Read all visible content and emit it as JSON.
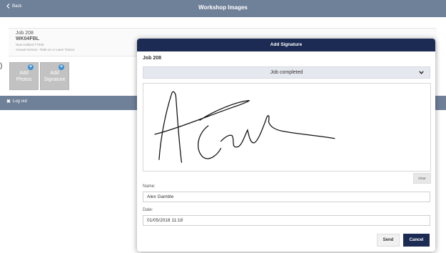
{
  "topbar": {
    "back_label": "Back",
    "title": "Workshop Images"
  },
  "job_card": {
    "job_number": "Job 208",
    "registration": "WK04FBL",
    "model": "New Holland T7030",
    "service": "Annual Service - Ride-on or Lawn Tractor"
  },
  "tiles": [
    {
      "label_line1": "Add",
      "label_line2": "Photos",
      "icon": "plus-circle-icon"
    },
    {
      "label_line1": "Add",
      "label_line2": "Signature",
      "icon": "plus-circle-icon"
    }
  ],
  "logout_label": "Log out",
  "modal": {
    "title": "Add Signature",
    "job": "Job 208",
    "status_selected": "Job completed",
    "clear_label": "Clear",
    "name_label": "Name:",
    "name_value": "Alex Gamble",
    "date_label": "Date:",
    "date_value": "01/05/2018 11:18",
    "send_label": "Send",
    "cancel_label": "Cancel"
  },
  "colors": {
    "topbar": "#6f8199",
    "modal_header": "#1b2b53",
    "tile": "#c2c2c2",
    "accent_icon": "#3b8fd6"
  }
}
